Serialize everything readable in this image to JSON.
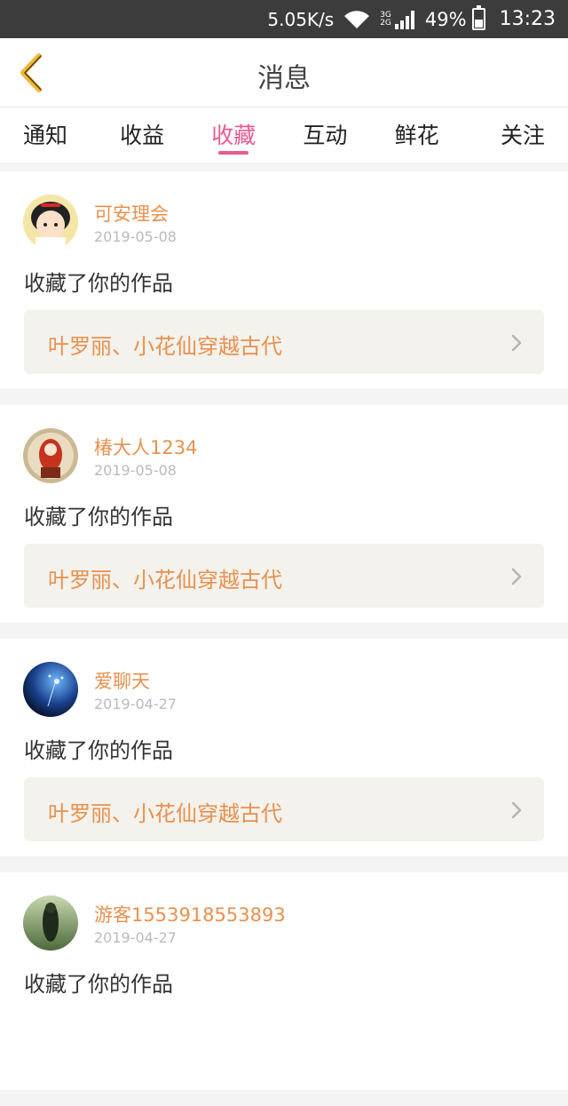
{
  "status_bar": {
    "network_speed": "5.05K/s",
    "signal_label_top": "3G",
    "signal_label_bottom": "2G",
    "battery": "49%",
    "battery_level": 0.49,
    "time": "13:23"
  },
  "header": {
    "title": "消息",
    "back_icon": "chevron-left-icon"
  },
  "tabs": [
    {
      "label": "通知",
      "active": false
    },
    {
      "label": "收益",
      "active": false
    },
    {
      "label": "收藏",
      "active": true
    },
    {
      "label": "互动",
      "active": false
    },
    {
      "label": "鲜花",
      "active": false
    },
    {
      "label": "关注",
      "active": false
    }
  ],
  "colors": {
    "accent": "#e85a91",
    "name": "#e8914f",
    "work_bg": "#f3f2ec",
    "back_icon": "#f0b83a"
  },
  "items": [
    {
      "user": "可安理会",
      "date": "2019-05-08",
      "action": "收藏了你的作品",
      "work": "叶罗丽、小花仙穿越古代"
    },
    {
      "user": "椿大人1234",
      "date": "2019-05-08",
      "action": "收藏了你的作品",
      "work": "叶罗丽、小花仙穿越古代"
    },
    {
      "user": "爱聊天",
      "date": "2019-04-27",
      "action": "收藏了你的作品",
      "work": "叶罗丽、小花仙穿越古代"
    },
    {
      "user": "游客1553918553893",
      "date": "2019-04-27",
      "action": "收藏了你的作品",
      "work": ""
    }
  ]
}
